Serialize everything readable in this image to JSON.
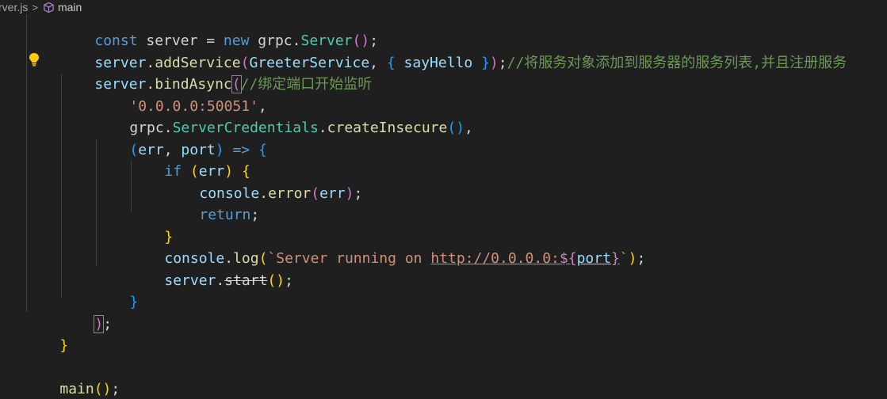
{
  "breadcrumb": {
    "file": "rver.js",
    "separator": ">",
    "symbol": "main"
  },
  "code": {
    "l1": {
      "a": "const",
      "b": " server ",
      "c": "=",
      "d": " new ",
      "e": "grpc",
      "f": ".",
      "g": "Server",
      "h": "()",
      "i": ";"
    },
    "l2": {
      "a": "server",
      "b": ".",
      "c": "addService",
      "d": "(",
      "e": "GreeterService",
      "f": ", ",
      "g": "{",
      "h": " sayHello ",
      "i": "}",
      "j": ")",
      "k": ";",
      "l": "//将服务对象添加到服务器的服务列表,并且注册服务"
    },
    "l3": {
      "a": "server",
      "b": ".",
      "c": "bindAsync",
      "d": "(",
      "e": "//绑定端口开始监听"
    },
    "l4": {
      "a": "'0.0.0.0:50051'",
      "b": ","
    },
    "l5": {
      "a": "grpc",
      "b": ".",
      "c": "ServerCredentials",
      "d": ".",
      "e": "createInsecure",
      "f": "()",
      "g": ","
    },
    "l6": {
      "a": "(",
      "b": "err",
      "c": ", ",
      "d": "port",
      "e": ")",
      "f": " => ",
      "g": "{"
    },
    "l7": {
      "a": "if",
      "b": " ",
      "c": "(",
      "d": "err",
      "e": ")",
      "f": " ",
      "g": "{"
    },
    "l8": {
      "a": "console",
      "b": ".",
      "c": "error",
      "d": "(",
      "e": "err",
      "f": ")",
      "g": ";"
    },
    "l9": {
      "a": "return",
      "b": ";"
    },
    "l10": {
      "a": "}"
    },
    "l11": {
      "a": "console",
      "b": ".",
      "c": "log",
      "d": "(",
      "e": "`Server running on ",
      "f": "http://0.0.0.0:",
      "g": "${",
      "h": "port",
      "i": "}",
      "j": "`",
      "k": ")",
      "l": ";"
    },
    "l12": {
      "a": "server",
      "b": ".",
      "c": "start",
      "d": "()",
      "e": ";"
    },
    "l13": {
      "a": "}"
    },
    "l14": {
      "a": ")",
      "b": ";"
    },
    "l15": {
      "a": "}"
    },
    "l16": {
      "a": "main",
      "b": "()",
      "c": ";"
    }
  },
  "icons": {
    "breadcrumb_symbol": "cube-icon",
    "lightbulb": "lightbulb-icon"
  },
  "colors": {
    "background": "#1f1f1f",
    "keyword": "#569cd6",
    "variable": "#9cdcfe",
    "function": "#dcdcaa",
    "class": "#4ec9b0",
    "string": "#ce9178",
    "comment": "#6a9955",
    "bracket_level1": "#ffd700",
    "bracket_level2": "#da70d6",
    "bracket_level3": "#179fff",
    "lightbulb": "#ffcc00"
  }
}
